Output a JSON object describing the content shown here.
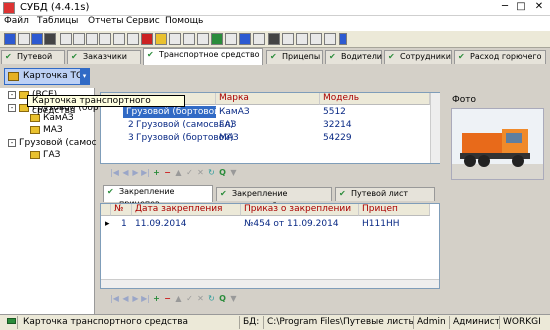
{
  "window": {
    "title": "СУБД (4.4.1s)"
  },
  "menu": [
    "Файл",
    "Таблицы",
    "Отчеты",
    "Сервис",
    "Помощь"
  ],
  "tabs": [
    "Путевой лист",
    "Заказчики",
    "Транспортное средство",
    "Прицепы",
    "Водители",
    "Сотрудники",
    "Расход горючего"
  ],
  "left": {
    "combo_label": "Карточка ТС",
    "tooltip": "Карточка транспортного средства",
    "tree": [
      {
        "label": "(ВСЕ)",
        "level": 1
      },
      {
        "label": "Грузовой (бор",
        "level": 1
      },
      {
        "label": "КамАЗ",
        "level": 2
      },
      {
        "label": "МАЗ",
        "level": 2
      },
      {
        "label": "Грузовой (самос",
        "level": 1
      },
      {
        "label": "ГАЗ",
        "level": 2
      }
    ]
  },
  "main_table": {
    "headers": [
      "Марка",
      "Модель"
    ],
    "rows": [
      {
        "num": "1",
        "type": "Грузовой (бортовой)",
        "brand": "КамАЗ",
        "model": "5512"
      },
      {
        "num": "2",
        "type": "Грузовой (самосвал)",
        "brand": "ГАЗ",
        "model": "32214"
      },
      {
        "num": "3",
        "type": "Грузовой (бортовой)",
        "brand": "МАЗ",
        "model": "54229"
      }
    ]
  },
  "right": {
    "photo_label": "Фото"
  },
  "subtabs": [
    "Закрепление прицепов",
    "Закрепление водителей",
    "Путевой лист"
  ],
  "sub_table": {
    "headers": [
      "№",
      "Дата закрепления",
      "Приказ о закреплении",
      "Прицеп"
    ],
    "rows": [
      {
        "num": "1",
        "date": "11.09.2014",
        "order": "№454 от 11.09.2014",
        "trailer": "Н111НН"
      }
    ]
  },
  "status": {
    "text": "Карточка транспортного средства",
    "db_label": "БД:",
    "path": "C:\\Program Files\\Путевые листы\\Put...",
    "user": "Admin",
    "role": "Админист",
    "machine": "WORKGI"
  }
}
